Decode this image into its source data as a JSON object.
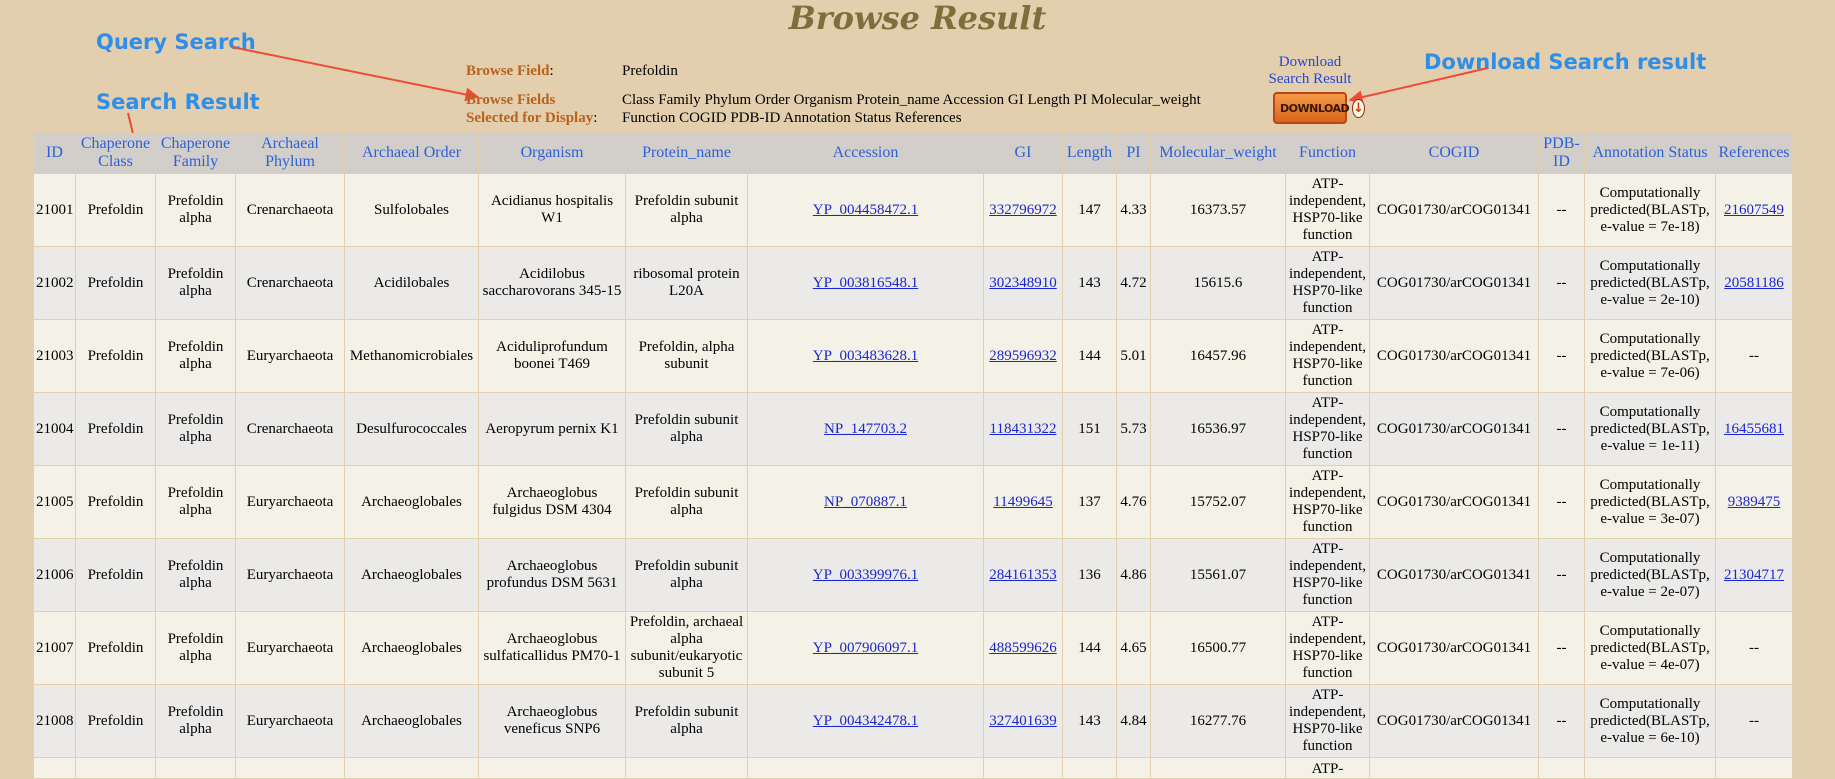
{
  "page": {
    "title": "Browse Result",
    "annotations": {
      "query_search": "Query Search",
      "search_result": "Search Result",
      "download_search_result": "Download Search result"
    },
    "browse_field_label": "Browse Field",
    "browse_field_value": "Prefoldin",
    "fields_selected_label_line1": "Browse Fields",
    "fields_selected_label_line2": "Selected for Display",
    "fields_selected_line1": "Class Family Phylum Order Organism Protein_name Accession GI Length PI Molecular_weight",
    "fields_selected_line2": "Function COGID PDB-ID Annotation Status References",
    "download_link_line1": "Download",
    "download_link_line2": "Search Result",
    "download_button_label": "DOWNLOAD",
    "colon": ":",
    "colors": {
      "background": "#e3cfae",
      "header_text": "#2d5fd8",
      "annotation": "#2f8ee8",
      "arrow": "#ee4b36",
      "label": "#b8621b"
    }
  },
  "table": {
    "headers": [
      "ID",
      "Chaperone Class",
      "Chaperone Family",
      "Archaeal Phylum",
      "Archaeal Order",
      "Organism",
      "Protein_name",
      "Accession",
      "GI",
      "Length",
      "PI",
      "Molecular_weight",
      "Function",
      "COGID",
      "PDB-ID",
      "Annotation Status",
      "References"
    ],
    "rows": [
      {
        "id": "21001",
        "class": "Prefoldin",
        "family": "Prefoldin alpha",
        "phylum": "Crenarchaeota",
        "order": "Sulfolobales",
        "organism": "Acidianus hospitalis W1",
        "protein": "Prefoldin subunit alpha",
        "accession": "YP_004458472.1",
        "gi": "332796972",
        "length": "147",
        "pi": "4.33",
        "mw": "16373.57",
        "function": "ATP-independent, HSP70-like function",
        "cogid": "COG01730/arCOG01341",
        "pdb": "--",
        "status": "Computationally predicted(BLASTp, e-value = 7e-18)",
        "ref": "21607549"
      },
      {
        "id": "21002",
        "class": "Prefoldin",
        "family": "Prefoldin alpha",
        "phylum": "Crenarchaeota",
        "order": "Acidilobales",
        "organism": "Acidilobus saccharovorans 345-15",
        "protein": "ribosomal protein L20A",
        "accession": "YP_003816548.1",
        "gi": "302348910",
        "length": "143",
        "pi": "4.72",
        "mw": "15615.6",
        "function": "ATP-independent, HSP70-like function",
        "cogid": "COG01730/arCOG01341",
        "pdb": "--",
        "status": "Computationally predicted(BLASTp, e-value = 2e-10)",
        "ref": "20581186"
      },
      {
        "id": "21003",
        "class": "Prefoldin",
        "family": "Prefoldin alpha",
        "phylum": "Euryarchaeota",
        "order": "Methanomicrobiales",
        "organism": "Aciduliprofundum boonei T469",
        "protein": "Prefoldin, alpha subunit",
        "accession": "YP_003483628.1",
        "gi": "289596932",
        "length": "144",
        "pi": "5.01",
        "mw": "16457.96",
        "function": "ATP-independent, HSP70-like function",
        "cogid": "COG01730/arCOG01341",
        "pdb": "--",
        "status": "Computationally predicted(BLASTp, e-value = 7e-06)",
        "ref": "--"
      },
      {
        "id": "21004",
        "class": "Prefoldin",
        "family": "Prefoldin alpha",
        "phylum": "Crenarchaeota",
        "order": "Desulfurococcales",
        "organism": "Aeropyrum pernix K1",
        "protein": "Prefoldin subunit alpha",
        "accession": "NP_147703.2",
        "gi": "118431322",
        "length": "151",
        "pi": "5.73",
        "mw": "16536.97",
        "function": "ATP-independent, HSP70-like function",
        "cogid": "COG01730/arCOG01341",
        "pdb": "--",
        "status": "Computationally predicted(BLASTp, e-value = 1e-11)",
        "ref": "16455681"
      },
      {
        "id": "21005",
        "class": "Prefoldin",
        "family": "Prefoldin alpha",
        "phylum": "Euryarchaeota",
        "order": "Archaeoglobales",
        "organism": "Archaeoglobus fulgidus DSM 4304",
        "protein": "Prefoldin subunit alpha",
        "accession": "NP_070887.1",
        "gi": "11499645",
        "length": "137",
        "pi": "4.76",
        "mw": "15752.07",
        "function": "ATP-independent, HSP70-like function",
        "cogid": "COG01730/arCOG01341",
        "pdb": "--",
        "status": "Computationally predicted(BLASTp, e-value = 3e-07)",
        "ref": "9389475"
      },
      {
        "id": "21006",
        "class": "Prefoldin",
        "family": "Prefoldin alpha",
        "phylum": "Euryarchaeota",
        "order": "Archaeoglobales",
        "organism": "Archaeoglobus profundus DSM 5631",
        "protein": "Prefoldin subunit alpha",
        "accession": "YP_003399976.1",
        "gi": "284161353",
        "length": "136",
        "pi": "4.86",
        "mw": "15561.07",
        "function": "ATP-independent, HSP70-like function",
        "cogid": "COG01730/arCOG01341",
        "pdb": "--",
        "status": "Computationally predicted(BLASTp, e-value = 2e-07)",
        "ref": "21304717"
      },
      {
        "id": "21007",
        "class": "Prefoldin",
        "family": "Prefoldin alpha",
        "phylum": "Euryarchaeota",
        "order": "Archaeoglobales",
        "organism": "Archaeoglobus sulfaticallidus PM70-1",
        "protein": "Prefoldin, archaeal alpha subunit/eukaryotic subunit 5",
        "accession": "YP_007906097.1",
        "gi": "488599626",
        "length": "144",
        "pi": "4.65",
        "mw": "16500.77",
        "function": "ATP-independent, HSP70-like function",
        "cogid": "COG01730/arCOG01341",
        "pdb": "--",
        "status": "Computationally predicted(BLASTp, e-value = 4e-07)",
        "ref": "--"
      },
      {
        "id": "21008",
        "class": "Prefoldin",
        "family": "Prefoldin alpha",
        "phylum": "Euryarchaeota",
        "order": "Archaeoglobales",
        "organism": "Archaeoglobus veneficus SNP6",
        "protein": "Prefoldin subunit alpha",
        "accession": "YP_004342478.1",
        "gi": "327401639",
        "length": "143",
        "pi": "4.84",
        "mw": "16277.76",
        "function": "ATP-independent, HSP70-like function",
        "cogid": "COG01730/arCOG01341",
        "pdb": "--",
        "status": "Computationally predicted(BLASTp, e-value = 6e-10)",
        "ref": "--"
      }
    ],
    "partial_row_function": "ATP-"
  }
}
